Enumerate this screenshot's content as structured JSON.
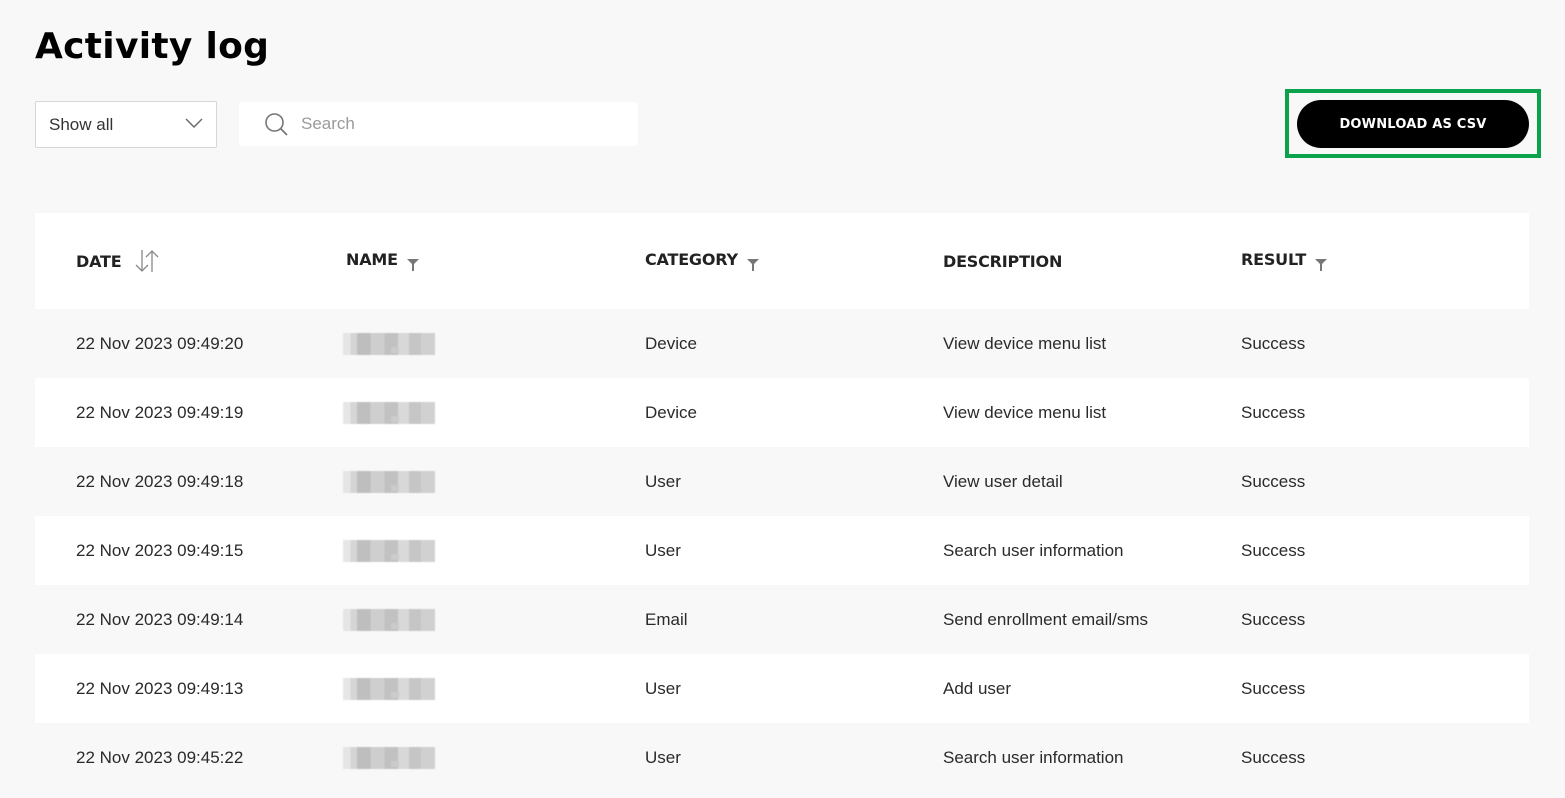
{
  "page": {
    "title": "Activity log"
  },
  "toolbar": {
    "filter_select": {
      "selected": "Show all"
    },
    "search": {
      "placeholder": "Search",
      "value": ""
    },
    "download_button_label": "DOWNLOAD AS CSV",
    "highlight_color": "#0aa24a"
  },
  "table": {
    "columns": [
      {
        "label": "DATE",
        "icon": "sort-icon"
      },
      {
        "label": "NAME",
        "icon": "filter-icon"
      },
      {
        "label": "CATEGORY",
        "icon": "filter-icon"
      },
      {
        "label": "DESCRIPTION",
        "icon": null
      },
      {
        "label": "RESULT",
        "icon": "filter-icon"
      }
    ],
    "rows": [
      {
        "date": "22 Nov 2023 09:49:20",
        "name": "[redacted]",
        "category": "Device",
        "description": "View device menu list",
        "result": "Success"
      },
      {
        "date": "22 Nov 2023 09:49:19",
        "name": "[redacted]",
        "category": "Device",
        "description": "View device menu list",
        "result": "Success"
      },
      {
        "date": "22 Nov 2023 09:49:18",
        "name": "[redacted]",
        "category": "User",
        "description": "View user detail",
        "result": "Success"
      },
      {
        "date": "22 Nov 2023 09:49:15",
        "name": "[redacted]",
        "category": "User",
        "description": "Search user information",
        "result": "Success"
      },
      {
        "date": "22 Nov 2023 09:49:14",
        "name": "[redacted]",
        "category": "Email",
        "description": "Send enrollment email/sms",
        "result": "Success"
      },
      {
        "date": "22 Nov 2023 09:49:13",
        "name": "[redacted]",
        "category": "User",
        "description": "Add user",
        "result": "Success"
      },
      {
        "date": "22 Nov 2023 09:45:22",
        "name": "[redacted]",
        "category": "User",
        "description": "Search user information",
        "result": "Success"
      }
    ]
  }
}
